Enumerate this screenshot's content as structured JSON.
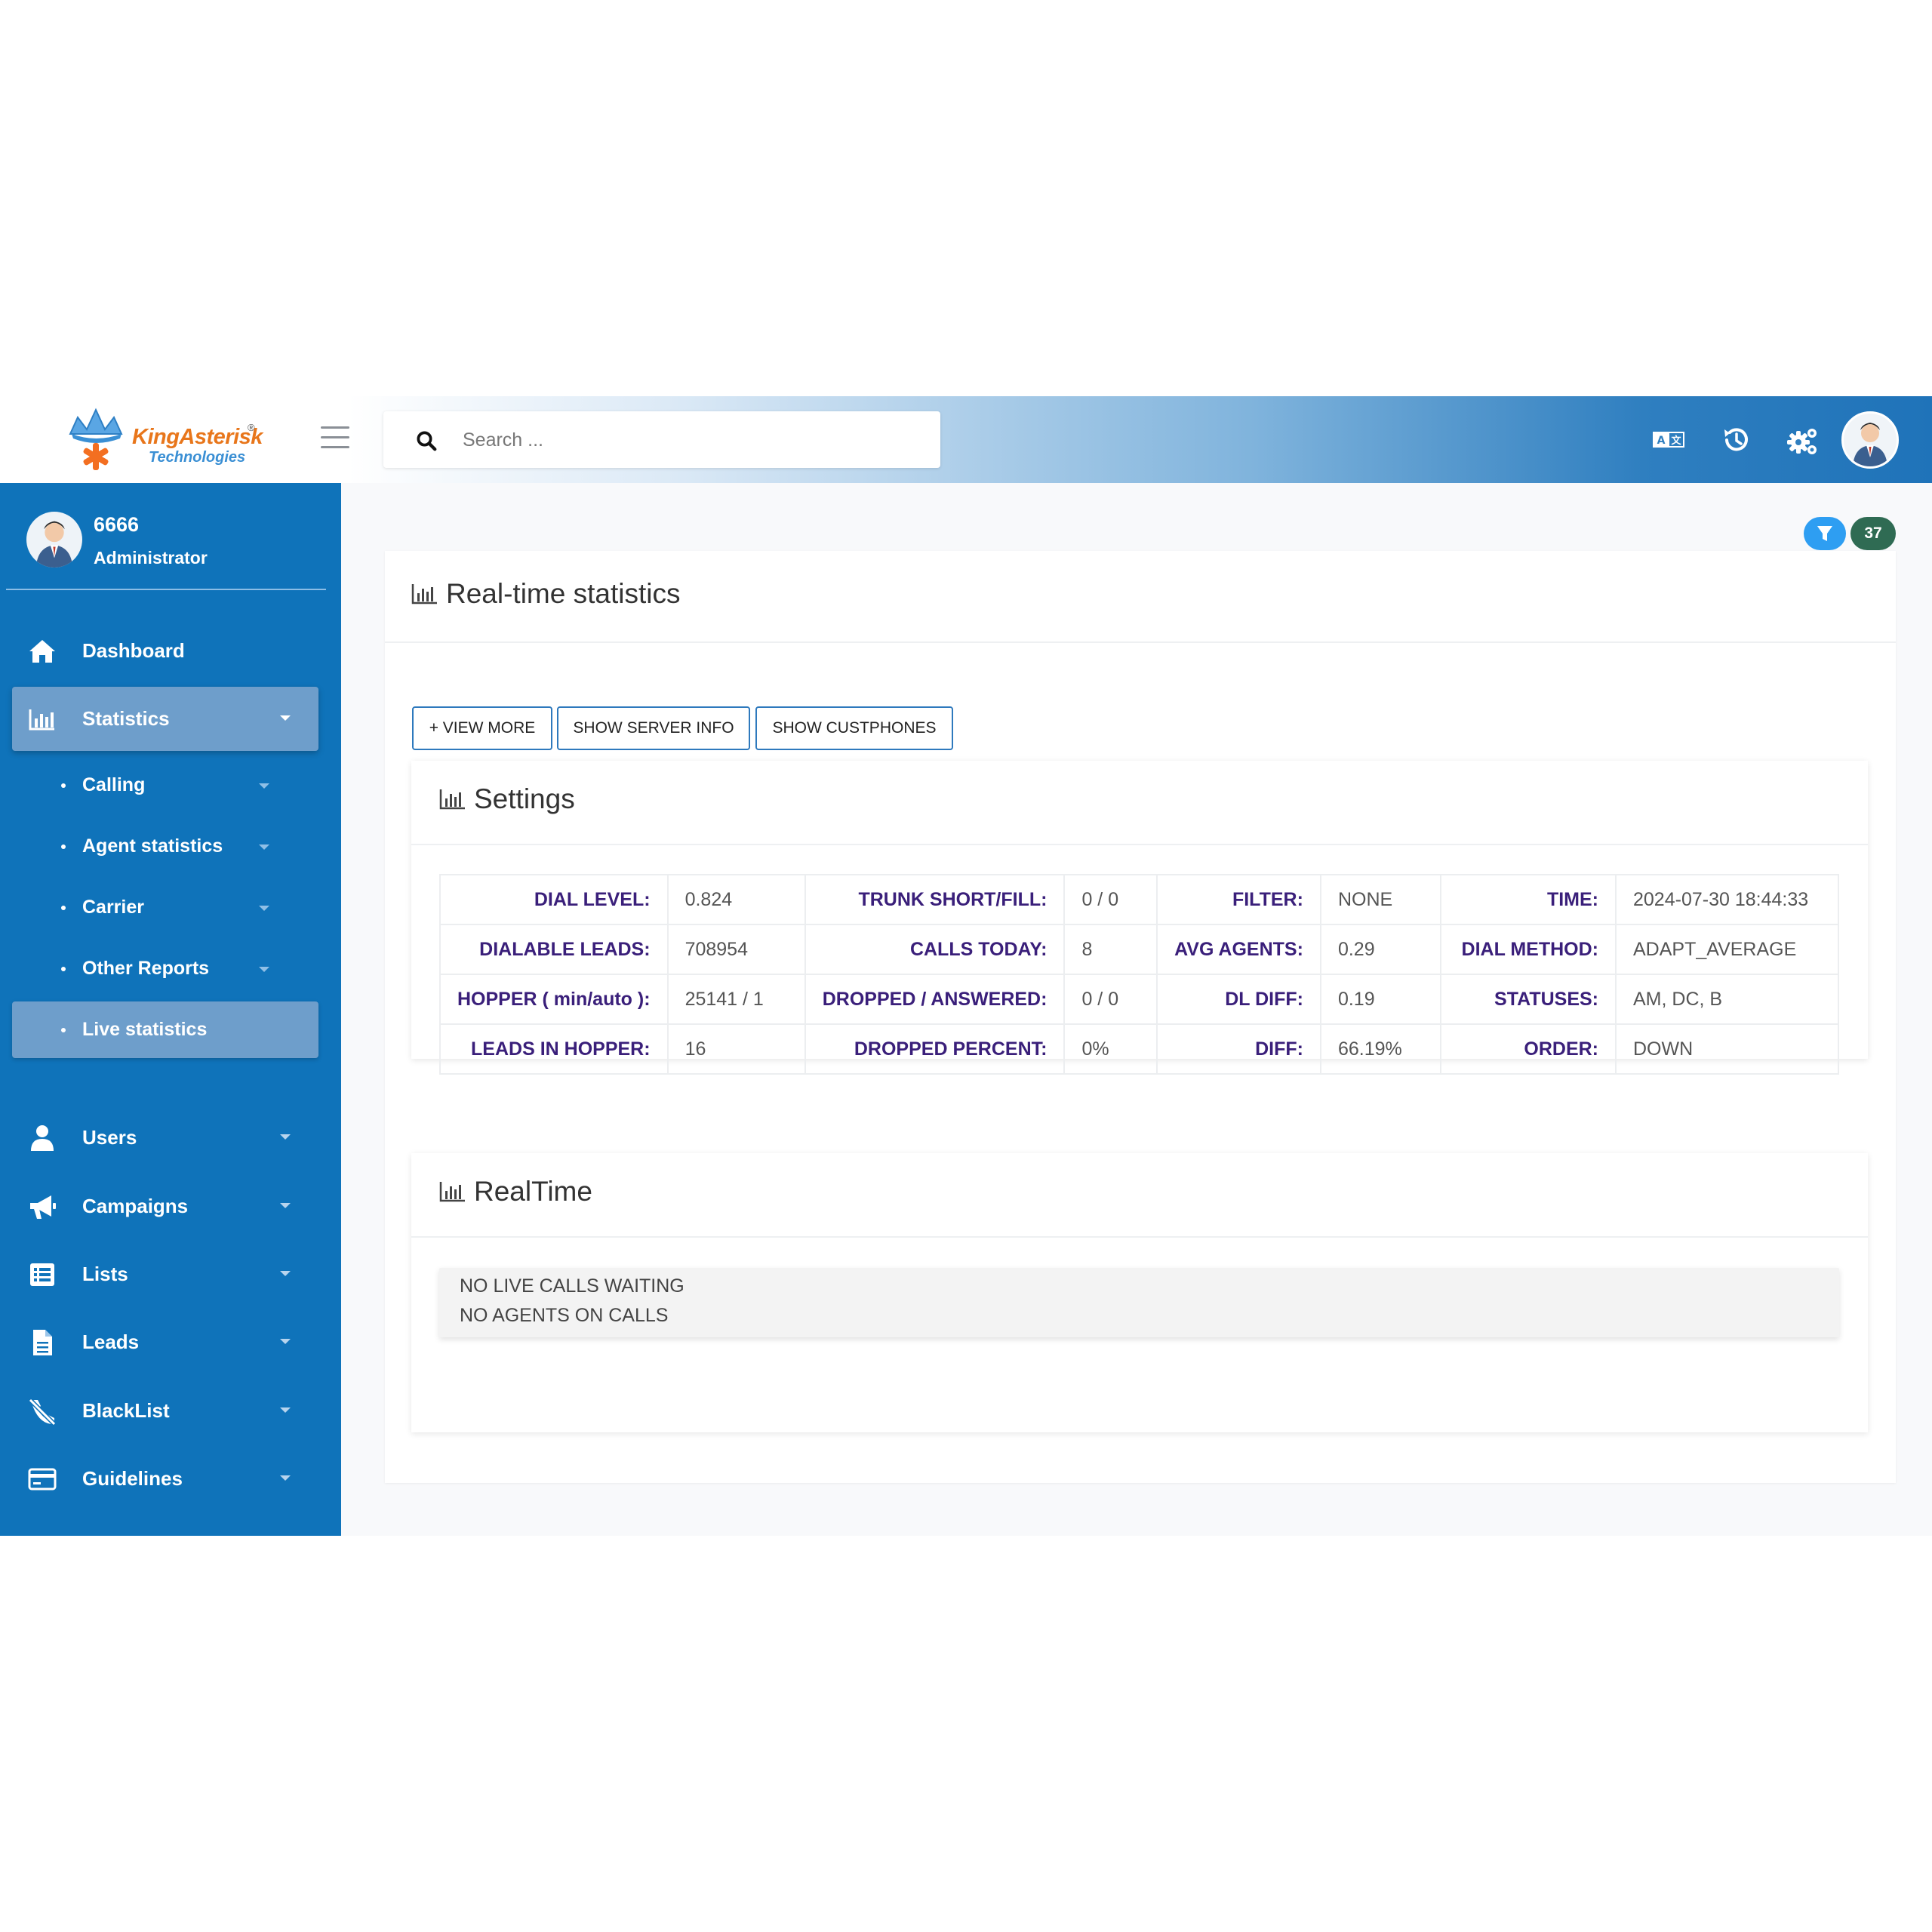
{
  "header": {
    "logo": {
      "line1": "KingAsterisk",
      "line2": "Technologies",
      "reg": "®"
    },
    "search": {
      "placeholder": "Search ..."
    },
    "icons": [
      "translate-icon",
      "history-icon",
      "settings-gears-icon",
      "user-avatar"
    ]
  },
  "sidebar": {
    "user": {
      "name": "6666",
      "role": "Administrator"
    },
    "items": [
      {
        "label": "Dashboard",
        "icon": "home-icon"
      },
      {
        "label": "Statistics",
        "icon": "bar-chart-icon"
      },
      {
        "label": "Users",
        "icon": "user-icon"
      },
      {
        "label": "Campaigns",
        "icon": "megaphone-icon"
      },
      {
        "label": "Lists",
        "icon": "list-icon"
      },
      {
        "label": "Leads",
        "icon": "file-icon"
      },
      {
        "label": "BlackList",
        "icon": "phone-slash-icon"
      },
      {
        "label": "Guidelines",
        "icon": "credit-card-icon"
      }
    ],
    "statistics_sub": [
      {
        "label": "Calling"
      },
      {
        "label": "Agent statistics"
      },
      {
        "label": "Carrier"
      },
      {
        "label": "Other Reports"
      },
      {
        "label": "Live statistics"
      }
    ]
  },
  "badges": {
    "count": "37"
  },
  "main": {
    "title": "Real-time statistics",
    "buttons": {
      "view_more": "+ VIEW MORE",
      "server_info": "SHOW SERVER INFO",
      "custphones": "SHOW CUSTPHONES"
    },
    "settings": {
      "title": "Settings",
      "rows": [
        [
          [
            "DIAL LEVEL:",
            "0.824"
          ],
          [
            "TRUNK SHORT/FILL:",
            "0 / 0"
          ],
          [
            "FILTER:",
            "NONE"
          ],
          [
            "TIME:",
            "2024-07-30 18:44:33"
          ]
        ],
        [
          [
            "DIALABLE LEADS:",
            "708954"
          ],
          [
            "CALLS TODAY:",
            "8"
          ],
          [
            "AVG AGENTS:",
            "0.29"
          ],
          [
            "DIAL METHOD:",
            "ADAPT_AVERAGE"
          ]
        ],
        [
          [
            "HOPPER ( min/auto ):",
            "25141 / 1"
          ],
          [
            "DROPPED / ANSWERED:",
            "0 / 0"
          ],
          [
            "DL DIFF:",
            "0.19"
          ],
          [
            "STATUSES:",
            "AM, DC, B"
          ]
        ],
        [
          [
            "LEADS IN HOPPER:",
            "16"
          ],
          [
            "DROPPED PERCENT:",
            "0%"
          ],
          [
            "DIFF:",
            "66.19%"
          ],
          [
            "ORDER:",
            "DOWN"
          ]
        ]
      ]
    },
    "realtime": {
      "title": "RealTime",
      "line1": "NO LIVE CALLS WAITING",
      "line2": "NO AGENTS ON CALLS"
    }
  },
  "colors": {
    "sidebar": "#0f73ba",
    "active": "#6e9ecb",
    "label": "#3a1f7a",
    "badge_filter": "#2e9ef2",
    "badge_count": "#2f6b53"
  }
}
